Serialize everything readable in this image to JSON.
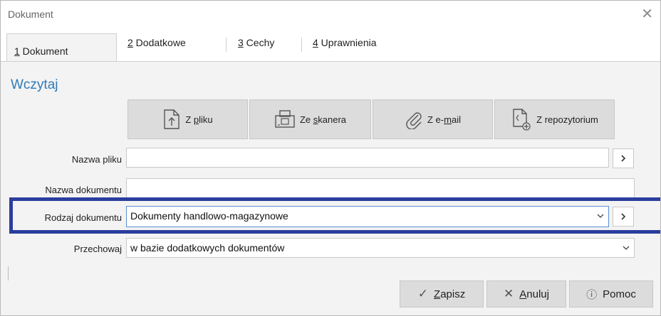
{
  "window": {
    "title": "Dokument"
  },
  "tabs": [
    {
      "key": "1",
      "rest": " Dokument"
    },
    {
      "key": "2",
      "rest": " Dodatkowe"
    },
    {
      "key": "3",
      "rest": " Cechy"
    },
    {
      "key": "4",
      "rest": " Uprawnienia"
    }
  ],
  "load": {
    "section_title": "Wczytaj",
    "buttons": [
      {
        "pre": "Z ",
        "key": "p",
        "post": "liku",
        "icon": "file-import-icon"
      },
      {
        "pre": "Ze ",
        "key": "s",
        "post": "kanera",
        "icon": "scanner-icon"
      },
      {
        "pre": "Z e-",
        "key": "m",
        "post": "ail",
        "icon": "paperclip-icon"
      },
      {
        "pre": "Z repozytorium",
        "key": "",
        "post": "",
        "icon": "repository-file-icon"
      }
    ]
  },
  "form": {
    "file_name": {
      "label": "Nazwa pliku",
      "value": ""
    },
    "doc_name": {
      "label": "Nazwa dokumentu",
      "value": ""
    },
    "doc_type": {
      "label": "Rodzaj dokumentu",
      "value": "Dokumenty handlowo-magazynowe"
    },
    "storage": {
      "label": "Przechowaj",
      "value": "w bazie dodatkowych dokumentów"
    }
  },
  "footer": {
    "save": {
      "key": "Z",
      "rest": "apisz"
    },
    "cancel": {
      "key": "A",
      "rest": "nuluj"
    },
    "help": {
      "label": "Pomoc"
    }
  },
  "colors": {
    "accent": "#2e7ab8",
    "highlight": "#2b3d9e"
  }
}
